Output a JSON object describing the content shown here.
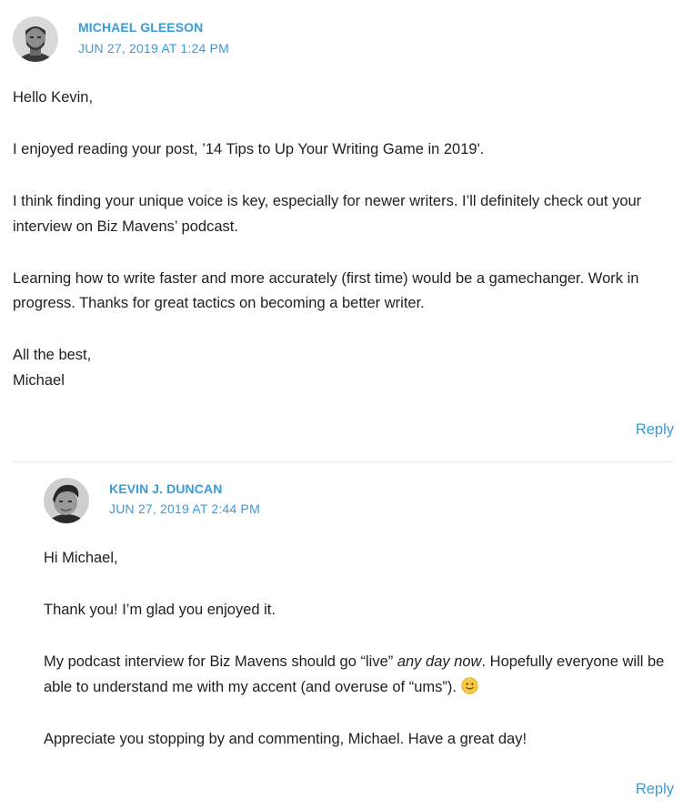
{
  "comments": [
    {
      "author": "MICHAEL GLEESON",
      "date": "JUN 27, 2019 AT 1:24 PM",
      "paragraphs": [
        "Hello Kevin,",
        "I enjoyed reading your post, ’14 Tips to Up Your Writing Game in 2019'.",
        "I think finding your unique voice is key, especially for newer writers. I’ll definitely check out your interview on Biz Mavens’ podcast.",
        "Learning how to write faster and more accurately (first time) would be a gamechanger. Work in progress. Thanks for great tactics on becoming a better writer."
      ],
      "signoff": [
        "All the best,",
        "Michael"
      ],
      "reply_label": "Reply"
    },
    {
      "author": "KEVIN J. DUNCAN",
      "date": "JUN 27, 2019 AT 2:44 PM",
      "paragraphs": [
        "Hi Michael,",
        "Thank you! I’m glad you enjoyed it."
      ],
      "p3_before": "My podcast interview for Biz Mavens should go “live” ",
      "p3_emph": "any day now",
      "p3_after": ". Hopefully everyone will be able to understand me with my accent (and overuse of “ums”). ",
      "emoji_icon": "slightly-smiling-face-icon",
      "p4": "Appreciate you stopping by and commenting, Michael. Have a great day!",
      "reply_label": "Reply"
    }
  ],
  "colors": {
    "accent": "#3a9bd9",
    "text": "#1f1f1f",
    "divider": "#e6e6e6"
  }
}
